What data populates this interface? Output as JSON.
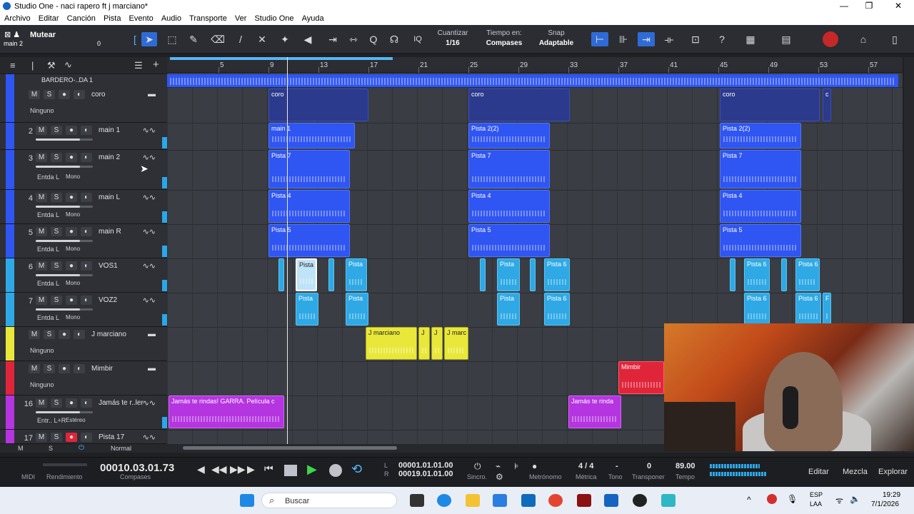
{
  "window": {
    "title": "Studio One - naci rapero ft j marciano*",
    "controls": [
      "—",
      "❐",
      "✕"
    ]
  },
  "menu": [
    "Archivo",
    "Editar",
    "Canción",
    "Pista",
    "Evento",
    "Audio",
    "Transporte",
    "Ver",
    "Studio One",
    "Ayuda"
  ],
  "toolbar": {
    "mute_label": "Mutear",
    "track_name": "main 2",
    "track_value": "0",
    "iq_label": "IQ",
    "quantize_label": "Cuantizar",
    "quantize_value": "1/16",
    "timebase_label": "Tiempo en:",
    "timebase_value": "Compases",
    "snap_label": "Snap",
    "snap_value": "Adaptable",
    "help": "?"
  },
  "ruler": {
    "ticks": [
      "5",
      "9",
      "13",
      "17",
      "21",
      "25",
      "29",
      "33",
      "37",
      "41",
      "45",
      "49",
      "53",
      "57"
    ]
  },
  "folder_top": {
    "label": "BARDERO-..DA 1"
  },
  "tracks": [
    {
      "num": "",
      "name": "coro",
      "input": "Ninguno",
      "type": "folder",
      "color": "#2f55f2"
    },
    {
      "num": "2",
      "name": "main 1",
      "input": "",
      "type": "audio",
      "color": "#2f55f2"
    },
    {
      "num": "3",
      "name": "main 2",
      "input": "Entda L",
      "mono": "Mono",
      "type": "audio",
      "color": "#2f55f2"
    },
    {
      "num": "4",
      "name": "main L",
      "input": "Entda L",
      "mono": "Mono",
      "type": "audio",
      "color": "#2f55f2"
    },
    {
      "num": "5",
      "name": "main R",
      "input": "Entda L",
      "mono": "Mono",
      "type": "audio",
      "color": "#2f55f2"
    },
    {
      "num": "6",
      "name": "VOS1",
      "input": "Entda L",
      "mono": "Mono",
      "type": "audio",
      "color": "#2ea9e6"
    },
    {
      "num": "7",
      "name": "VOZ2",
      "input": "Entda L",
      "mono": "Mono",
      "type": "audio",
      "color": "#2ea9e6"
    },
    {
      "num": "",
      "name": "J marciano",
      "input": "Ninguno",
      "type": "folder",
      "color": "#e9e83a"
    },
    {
      "num": "",
      "name": "Mimbir",
      "input": "Ninguno",
      "type": "folder",
      "color": "#e0253a"
    },
    {
      "num": "16",
      "name": "Jamás te r..ler",
      "input": "Entr.. L+R",
      "mono": "Estéreo",
      "type": "audio",
      "color": "#b535e0"
    },
    {
      "num": "17",
      "name": "Pista 17",
      "input": "",
      "type": "audio",
      "color": "#b535e0"
    }
  ],
  "clips": {
    "coro_1": "coro",
    "coro_2": "coro",
    "coro_3": "coro",
    "coro_4": "c",
    "main1_1": "main 1",
    "main1_2": "Pista 2(2)",
    "main1_3": "Pista 2(2)",
    "p7": "Pista 7",
    "p4": "Pista 4",
    "p5": "Pista 5",
    "pista": "Pista",
    "pista6": "Pista 6",
    "pista6b": "Pista 6",
    "pistaF": "F",
    "jm_1": "J marciano",
    "jm_2": "J",
    "jm_3": "J",
    "jm_4": "J marc",
    "mimbir": "Mimbir",
    "jamas_1": "Jamás te rindas! GARRA. Película c",
    "jamas_2": "Jamás te rinda"
  },
  "bottom_bar": {
    "m": "M",
    "s": "S",
    "mode": "Normal"
  },
  "transport": {
    "midi_label": "MIDI",
    "perf_label": "Rendimiento",
    "position": "00010.03.01.73",
    "position_unit": "Compases",
    "l_pos": "00001.01.01.00",
    "r_pos": "00019.01.01.00",
    "l": "L",
    "r": "R",
    "sync_label": "Sincro.",
    "metronome_label": "Metrónomo",
    "meter_value": "4 / 4",
    "meter_label": "Métrica",
    "key_value": "-",
    "key_label": "Tono",
    "transpose_value": "0",
    "transpose_label": "Transponer",
    "tempo_value": "89.00",
    "tempo_label": "Tempo",
    "edit_tab": "Editar",
    "mix_tab": "Mezcla",
    "browse_tab": "Explorar"
  },
  "taskbar": {
    "search_placeholder": "Buscar",
    "lang": "ESP",
    "lang2": "LAA",
    "time": "19:29",
    "date": "7/1/2026"
  }
}
